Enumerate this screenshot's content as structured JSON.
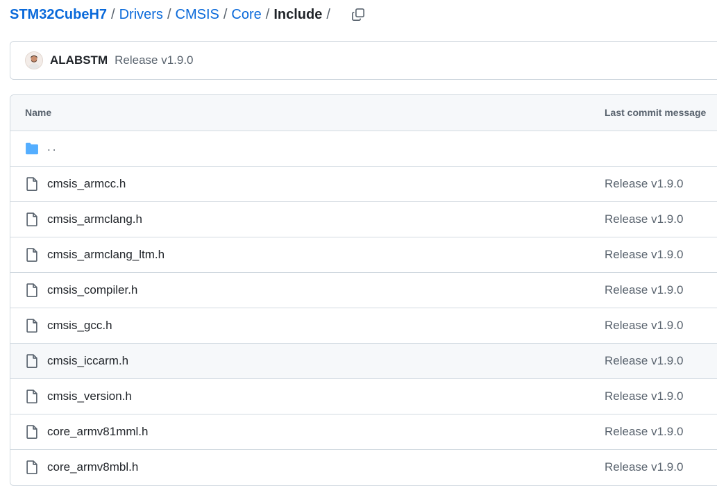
{
  "breadcrumb": {
    "repo": "STM32CubeH7",
    "parts": [
      "Drivers",
      "CMSIS",
      "Core"
    ],
    "current": "Include",
    "separator": "/",
    "copy_icon": "copy-icon"
  },
  "latest_commit": {
    "author": "ALABSTM",
    "message": "Release v1.9.0",
    "avatar_icon": "avatar"
  },
  "table": {
    "headers": {
      "name": "Name",
      "last_commit": "Last commit message"
    },
    "parent_link": "..",
    "files": [
      {
        "name": "cmsis_armcc.h",
        "message": "Release v1.9.0"
      },
      {
        "name": "cmsis_armclang.h",
        "message": "Release v1.9.0"
      },
      {
        "name": "cmsis_armclang_ltm.h",
        "message": "Release v1.9.0"
      },
      {
        "name": "cmsis_compiler.h",
        "message": "Release v1.9.0"
      },
      {
        "name": "cmsis_gcc.h",
        "message": "Release v1.9.0"
      },
      {
        "name": "cmsis_iccarm.h",
        "message": "Release v1.9.0"
      },
      {
        "name": "cmsis_version.h",
        "message": "Release v1.9.0"
      },
      {
        "name": "core_armv81mml.h",
        "message": "Release v1.9.0"
      },
      {
        "name": "core_armv8mbl.h",
        "message": "Release v1.9.0"
      }
    ]
  },
  "colors": {
    "link": "#0969da",
    "folder": "#54aeff",
    "muted": "#59636e",
    "border": "#d1d9e0"
  }
}
